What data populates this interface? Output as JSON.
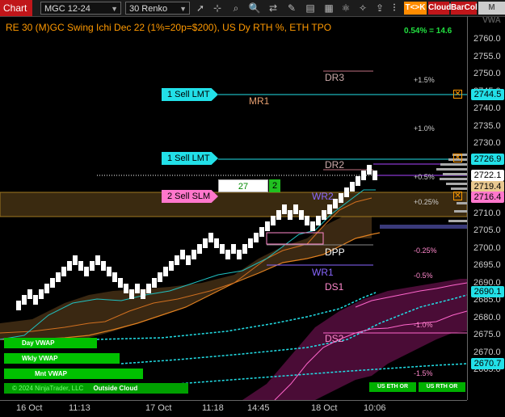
{
  "toolbar": {
    "chart_tab": "Chart",
    "instrument": "MGC 12-24",
    "bar_type": "30 Renko",
    "icons": [
      "pointer-icon",
      "crosshair-icon",
      "magnify-icon",
      "zoom-icon",
      "text-icon",
      "draw-icon",
      "template-icon",
      "properties-icon",
      "strategy-icon",
      "dataseries-icon",
      "share-icon"
    ],
    "t_k_label": "T<>K",
    "cloud_label": "Cloud",
    "barcol_label": "BarCol",
    "mvwa_label": "M VWA"
  },
  "chart": {
    "header": "RE 30 (M)GC Swing Ichi Dec 22 (1%=20p=$200), US Dy RTH %, ETH TPO",
    "top_right_value": "0.54% = 14.6",
    "colors": {
      "header": "#ff9900",
      "up_brick": "#ffffff",
      "cloud_fill": "#3a2a12",
      "pink_cloud": "#5a1040",
      "order_cyan": "#22e0e8",
      "order_pink": "#ff77cc"
    },
    "levels": [
      {
        "label": "DR3",
        "price": 2751.2
      },
      {
        "label": "MR1",
        "price": 2742.1
      },
      {
        "label": "DR2",
        "price": 2726.0
      },
      {
        "label": "WR2",
        "price": 2717.0
      },
      {
        "label": "DPP",
        "price": 2702.4
      },
      {
        "label": "WR1",
        "price": 2695.0
      },
      {
        "label": "DS1",
        "price": 2691.9
      },
      {
        "label": "DS2",
        "price": 2677.7
      }
    ],
    "pct_labels": [
      "+1.5%",
      "+1.0%",
      "+0.5%",
      "+0.25%",
      "-0.25%",
      "-0.5%",
      "-1.0%",
      "-1.5%"
    ],
    "orders": [
      {
        "label": "1 Sell LMT",
        "price": 2744.5
      },
      {
        "label": "1 Sell LMT",
        "price": 2726.9
      },
      {
        "label": "2 Sell SLM",
        "price": 2716.4
      }
    ],
    "position": {
      "qty": "27",
      "count": "2"
    },
    "vwap_labels": [
      "Day VWAP",
      "Wkly VWAP",
      "Mnt VWAP"
    ],
    "copyright": "© 2024 NinjaTrader, LLC",
    "cloud_status": "Outside Cloud",
    "session_buttons": [
      "US ETH OR",
      "US RTH OR"
    ]
  },
  "yaxis": {
    "ticks": [
      "2760.0",
      "2755.0",
      "2750.0",
      "2745.0",
      "2740.0",
      "2735.0",
      "2730.0",
      "2725.0",
      "2720.0",
      "2715.0",
      "2710.0",
      "2705.0",
      "2700.0",
      "2695.0",
      "2690.0",
      "2685.0",
      "2680.0",
      "2675.0",
      "2670.0",
      "2665.0"
    ],
    "price_tags": [
      {
        "text": "2744.5",
        "color": "#22e0e8"
      },
      {
        "text": "2726.9",
        "color": "#22e0e8"
      },
      {
        "text": "2722.1",
        "color": "#ffffff"
      },
      {
        "text": "2719.4",
        "color": "#e8c890"
      },
      {
        "text": "2716.4",
        "color": "#ff77cc"
      },
      {
        "text": "2690.1",
        "color": "#22e0e8"
      },
      {
        "text": "2670.7",
        "color": "#22e0e8"
      }
    ]
  },
  "xaxis": {
    "ticks": [
      "16 Oct",
      "11:13",
      "17 Oct",
      "11:18",
      "14:45",
      "18 Oct",
      "10:06"
    ]
  }
}
